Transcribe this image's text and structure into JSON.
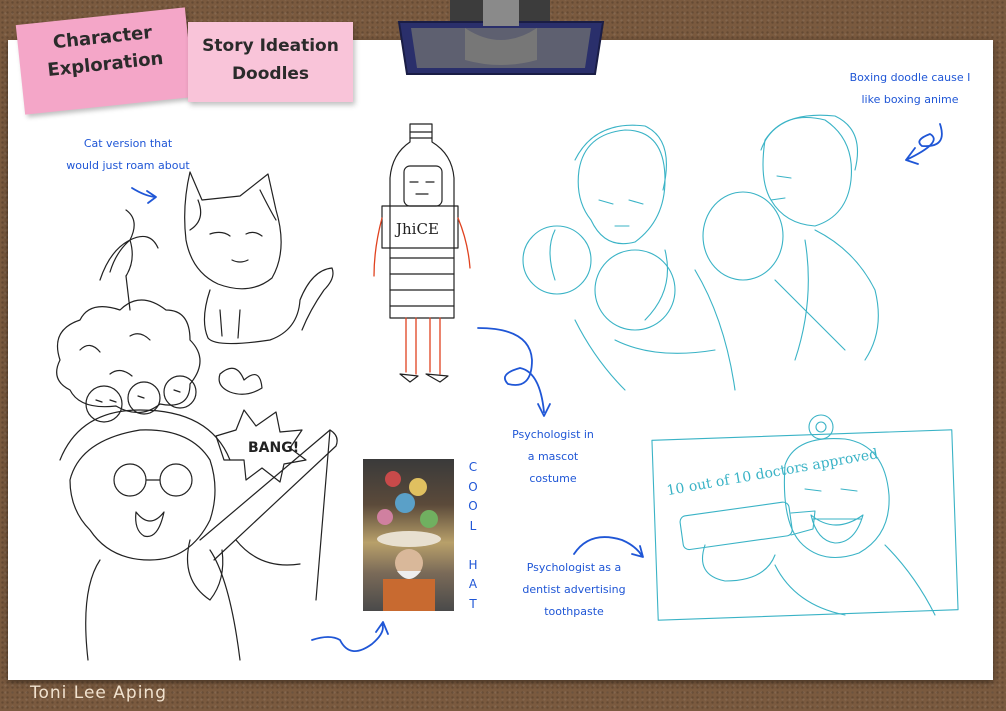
{
  "notes": {
    "character_exploration": [
      "Character",
      "Exploration"
    ],
    "story_ideation": [
      "Story Ideation",
      "Doodles"
    ]
  },
  "annotations": {
    "cat": [
      "Cat version that",
      "would just roam about"
    ],
    "boxing": [
      "Boxing doodle cause I",
      "like boxing anime"
    ],
    "mascot": [
      "Psychologist in",
      "a mascot",
      "costume"
    ],
    "dentist": [
      "Psychologist as a",
      "dentist advertising",
      "toothpaste"
    ],
    "cool_hat": [
      "C",
      "O",
      "O",
      "L",
      "",
      "H",
      "A",
      "T"
    ]
  },
  "sketch_text": {
    "juice_label": "JhiCE",
    "bang": "BANG!",
    "toothpaste": "10 out of 10 doctors approved"
  },
  "author": "Toni Lee Aping",
  "colors": {
    "board_bg": "#7a5a3f",
    "paper": "#ffffff",
    "note_pink": "#f4a6c8",
    "note_light_pink": "#f9c4d9",
    "annotation_blue": "#1f56d6",
    "sketch_cyan": "#3ab3c6",
    "sketch_red": "#e0421f"
  }
}
